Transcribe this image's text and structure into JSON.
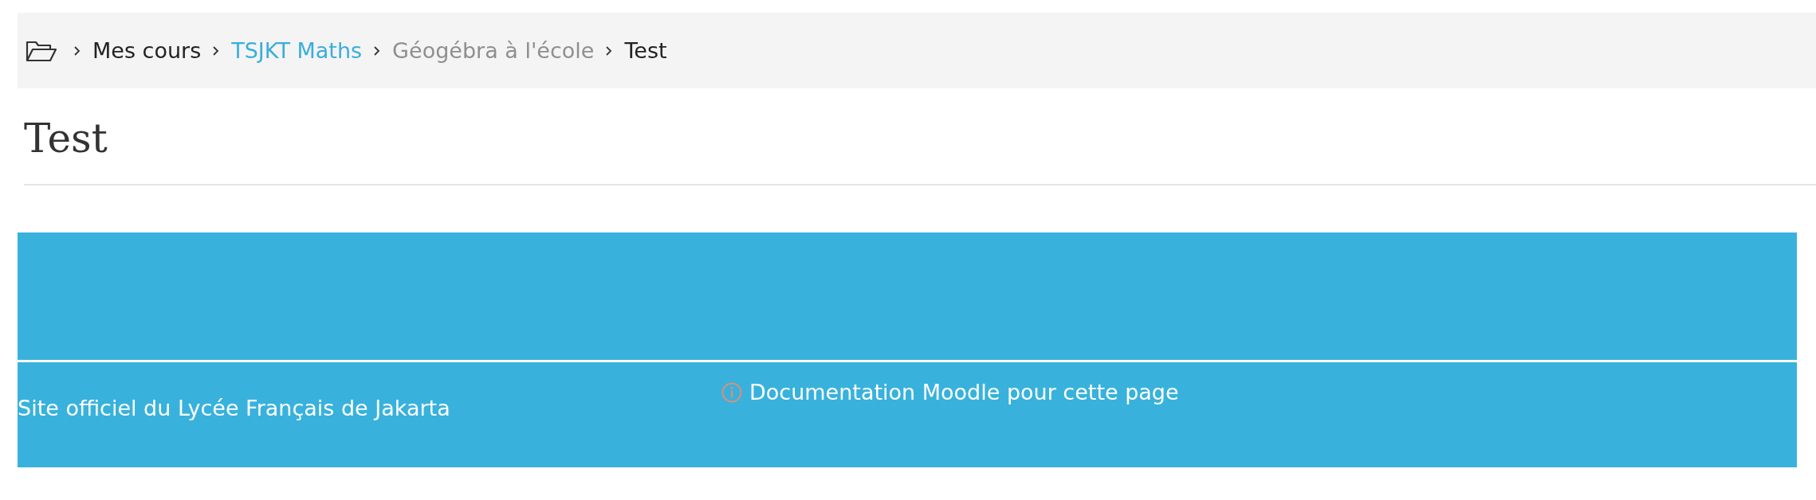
{
  "breadcrumb": [
    {
      "label": "Mes cours",
      "kind": "plain"
    },
    {
      "label": "TSJKT Maths",
      "kind": "link"
    },
    {
      "label": "Géogébra à l'école",
      "kind": "muted"
    },
    {
      "label": "Test",
      "kind": "plain"
    }
  ],
  "page_title": "Test",
  "footer": {
    "site_text": "Site officiel du Lycée Français de Jakarta",
    "docs_link": "Documentation Moodle pour cette page"
  }
}
